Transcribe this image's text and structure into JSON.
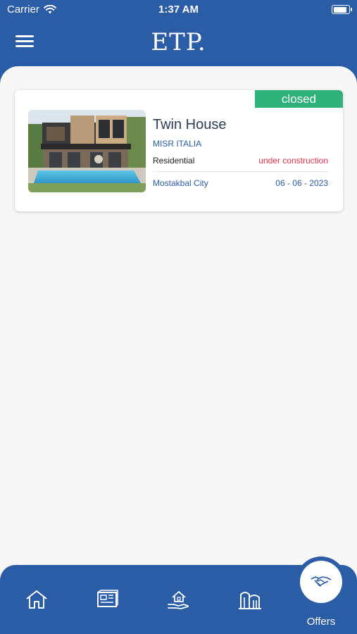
{
  "status_bar": {
    "carrier": "Carrier",
    "time": "1:37 AM",
    "battery_level": 0.9
  },
  "header": {
    "logo": "ETP."
  },
  "projects": [
    {
      "status_badge": "closed",
      "name": "Twin House",
      "developer": "MISR ITALIA",
      "category": "Residential",
      "stage": "under construction",
      "location": "Mostakbal City",
      "date": "06 - 06 - 2023"
    }
  ],
  "tab_bar": {
    "tabs": [
      {
        "icon": "home-icon"
      },
      {
        "icon": "blueprint-icon"
      },
      {
        "icon": "house-hand-icon"
      },
      {
        "icon": "buildings-icon"
      },
      {
        "icon": "handshake-icon",
        "label": "Offers",
        "active": true
      }
    ]
  },
  "colors": {
    "primary": "#2b5ca6",
    "closed_badge": "#2fb27a",
    "stage_text": "#e5324a",
    "background": "#f7f7f7"
  }
}
